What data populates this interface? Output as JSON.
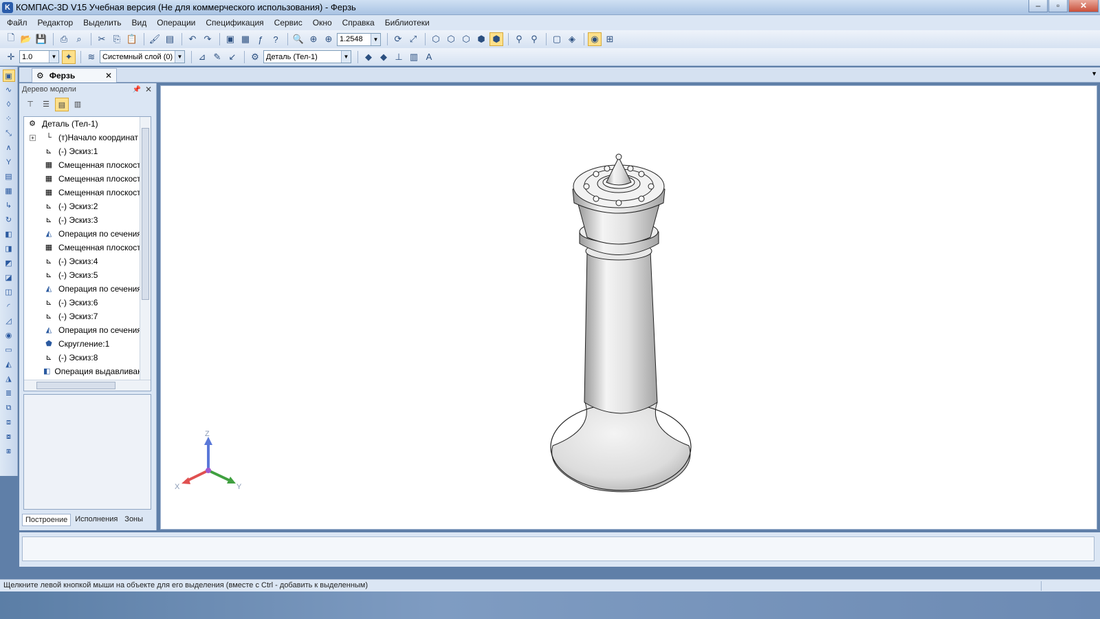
{
  "window": {
    "title": "КОМПАС-3D V15 Учебная версия (Не для коммерческого использования) - Ферзь",
    "app_icon": "kompas-icon"
  },
  "menu": [
    "Файл",
    "Редактор",
    "Выделить",
    "Вид",
    "Операции",
    "Спецификация",
    "Сервис",
    "Окно",
    "Справка",
    "Библиотеки"
  ],
  "toolbar": {
    "zoom_value": "1.2548",
    "step_value": "1.0",
    "layer_value": "Системный слой (0)",
    "part_value": "Деталь (Тел-1)"
  },
  "document": {
    "tab_title": "Ферзь"
  },
  "model_tree": {
    "header": "Дерево модели",
    "items": [
      {
        "label": "Деталь (Тел-1)",
        "icon": "part-icon",
        "root": true
      },
      {
        "label": "(т)Начало координат",
        "icon": "origin-icon"
      },
      {
        "label": "(-) Эскиз:1",
        "icon": "sketch-icon"
      },
      {
        "label": "Смещенная плоскость",
        "icon": "plane-icon"
      },
      {
        "label": "Смещенная плоскость",
        "icon": "plane-icon"
      },
      {
        "label": "Смещенная плоскость",
        "icon": "plane-icon"
      },
      {
        "label": "(-) Эскиз:2",
        "icon": "sketch-icon"
      },
      {
        "label": "(-) Эскиз:3",
        "icon": "sketch-icon"
      },
      {
        "label": "Операция по сечениям",
        "icon": "loft-icon"
      },
      {
        "label": "Смещенная плоскость",
        "icon": "plane-icon"
      },
      {
        "label": "(-) Эскиз:4",
        "icon": "sketch-icon"
      },
      {
        "label": "(-) Эскиз:5",
        "icon": "sketch-icon"
      },
      {
        "label": "Операция по сечениям",
        "icon": "loft-icon"
      },
      {
        "label": "(-) Эскиз:6",
        "icon": "sketch-icon"
      },
      {
        "label": "(-) Эскиз:7",
        "icon": "sketch-icon"
      },
      {
        "label": "Операция по сечениям",
        "icon": "loft-icon"
      },
      {
        "label": "Скругление:1",
        "icon": "fillet-icon"
      },
      {
        "label": "(-) Эскиз:8",
        "icon": "sketch-icon"
      },
      {
        "label": "Операция выдавливания",
        "icon": "extrude-icon"
      }
    ],
    "tabs": [
      "Построение",
      "Исполнения",
      "Зоны"
    ]
  },
  "axes": {
    "x": "X",
    "y": "Y",
    "z": "Z"
  },
  "status": {
    "text": "Щелкните левой кнопкой мыши на объекте для его выделения (вместе с Ctrl - добавить к выделенным)"
  },
  "colors": {
    "chrome": "#dbe6f4",
    "highlight": "#fde08a",
    "axis_x": "#e05050",
    "axis_y": "#40a040",
    "axis_z": "#5a78d8"
  }
}
